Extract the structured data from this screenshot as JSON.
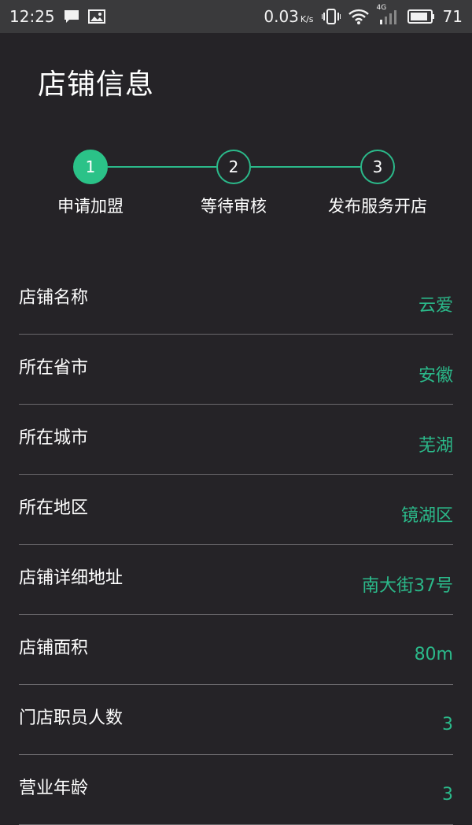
{
  "status_bar": {
    "time": "12:25",
    "speed": "0.03",
    "speed_unit": "K/s",
    "network": "4G",
    "battery": "71"
  },
  "page": {
    "title": "店铺信息"
  },
  "steps": [
    {
      "number": "1",
      "label": "申请加盟",
      "active": true
    },
    {
      "number": "2",
      "label": "等待审核",
      "active": false
    },
    {
      "number": "3",
      "label": "发布服务开店",
      "active": false
    }
  ],
  "rows": [
    {
      "label": "店铺名称",
      "value": "云爱"
    },
    {
      "label": "所在省市",
      "value": "安徽"
    },
    {
      "label": "所在城市",
      "value": "芜湖"
    },
    {
      "label": "所在地区",
      "value": "镜湖区"
    },
    {
      "label": "店铺详细地址",
      "value": "南大街37号"
    },
    {
      "label": "店铺面积",
      "value": "80m"
    },
    {
      "label": "门店职员人数",
      "value": "3"
    },
    {
      "label": "营业年龄",
      "value": "3"
    }
  ],
  "colors": {
    "accent": "#2bb98a",
    "background": "#252327",
    "statusbar": "#3a3a3c"
  }
}
